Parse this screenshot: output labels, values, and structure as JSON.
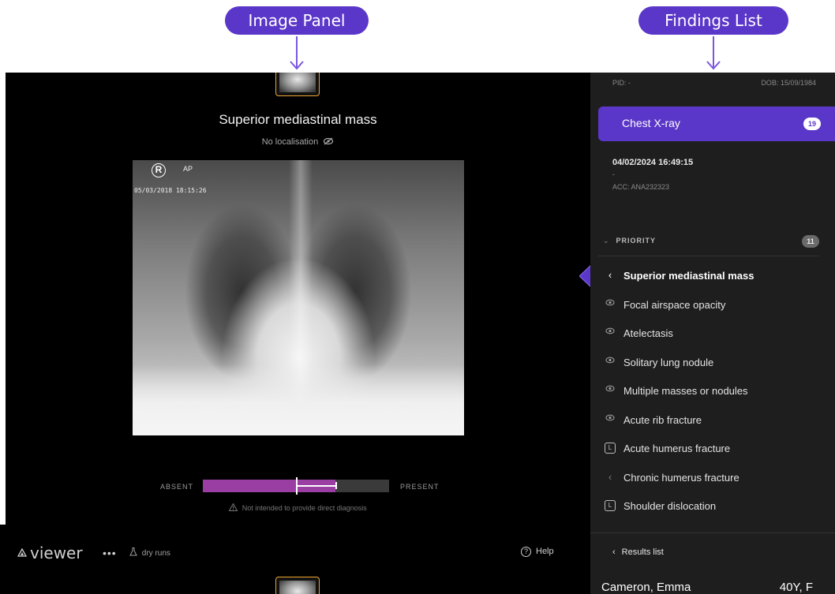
{
  "callouts": {
    "image_panel": "Image Panel",
    "findings_list": "Findings List"
  },
  "colors": {
    "accent": "#5b37c9",
    "gauge_fill": "#9b3ea3",
    "thumb_border": "#f0a531"
  },
  "viewer": {
    "finding_title": "Superior mediastinal mass",
    "localisation": "No localisation",
    "xray_marker": "R",
    "xray_view": "AP",
    "xray_timestamp": "05/03/2018 18:15:26",
    "gauge": {
      "absent_label": "ABSENT",
      "present_label": "PRESENT",
      "score_fraction": 0.5,
      "range_low_fraction": 0.5,
      "range_high_fraction": 0.71
    },
    "disclaimer": "Not intended to provide direct diagnosis"
  },
  "bottom_bar": {
    "app_name": "viewer",
    "menu_label": "•••",
    "dry_runs": "dry runs",
    "help": "Help"
  },
  "side": {
    "pid": "PID: -",
    "dob": "DOB: 15/09/1984",
    "study_label": "Chest X-ray",
    "study_count": "19",
    "study_date": "04/02/2024 16:49:15",
    "study_dash": "-",
    "acc": "ACC: ANA232323",
    "priority_label": "PRIORITY",
    "priority_count": "11",
    "findings": [
      {
        "label": "Superior mediastinal mass",
        "icon": "chevron-left-icon",
        "active": true
      },
      {
        "label": "Focal airspace opacity",
        "icon": "eye-icon",
        "active": false
      },
      {
        "label": "Atelectasis",
        "icon": "eye-icon",
        "active": false
      },
      {
        "label": "Solitary lung nodule",
        "icon": "eye-icon",
        "active": false
      },
      {
        "label": "Multiple masses or nodules",
        "icon": "eye-icon",
        "active": false
      },
      {
        "label": "Acute rib fracture",
        "icon": "eye-icon",
        "active": false
      },
      {
        "label": "Acute humerus fracture",
        "icon": "laterality-l-icon",
        "active": false
      },
      {
        "label": "Chronic humerus fracture",
        "icon": "chevron-left-icon",
        "active": false
      },
      {
        "label": "Shoulder dislocation",
        "icon": "laterality-l-icon",
        "active": false
      }
    ],
    "results_list": "Results list",
    "patient_name": "Cameron, Emma",
    "patient_age_sex": "40Y, F"
  }
}
